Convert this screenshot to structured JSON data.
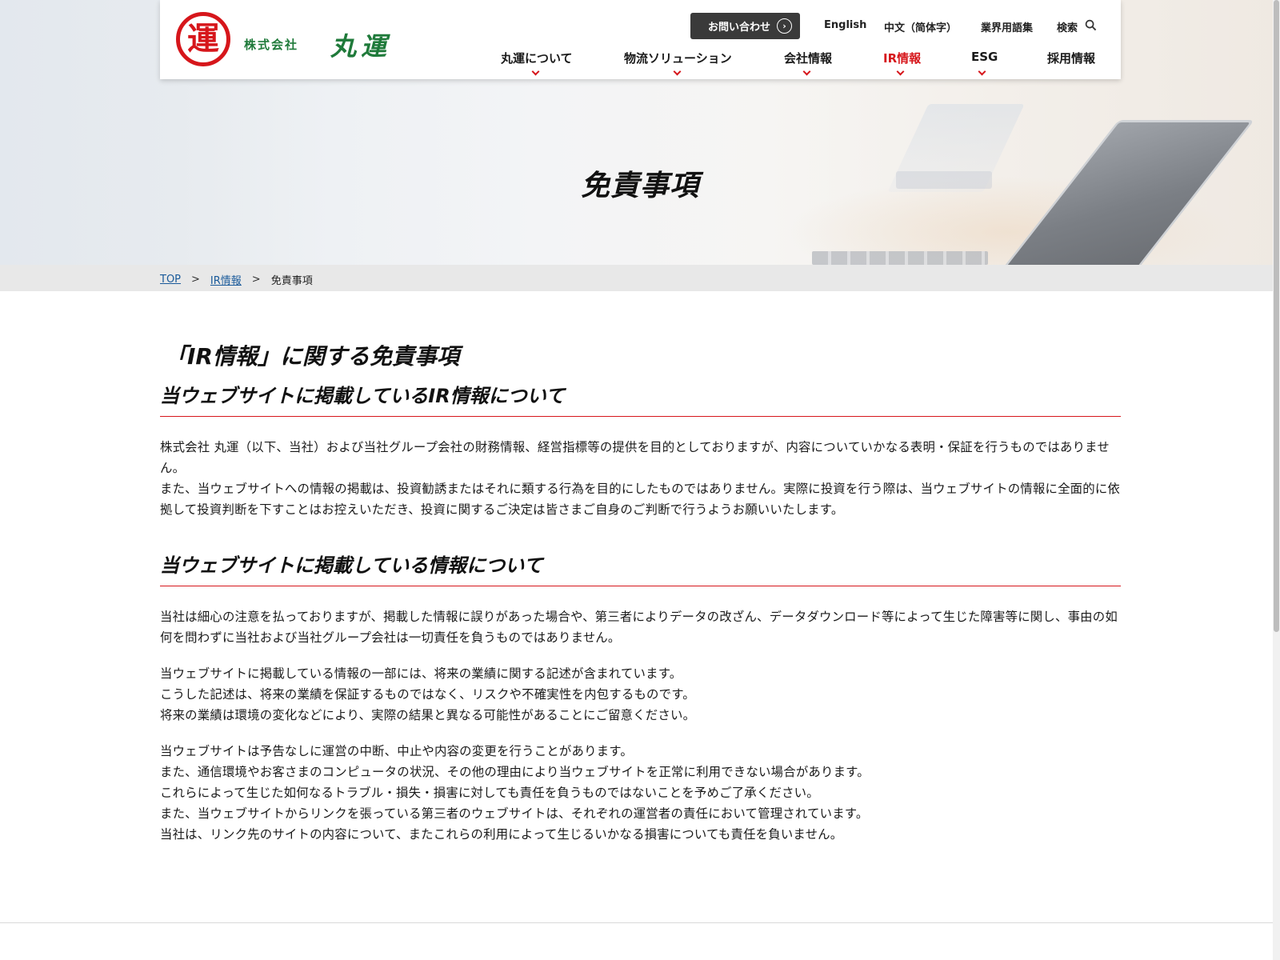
{
  "header": {
    "logo_mark": "運",
    "logo_company": "株式会社",
    "logo_name": "丸運",
    "contact_button": "お問い合わせ",
    "utility_links": [
      "English",
      "中文（简体字）",
      "業界用語集",
      "検索"
    ],
    "nav": [
      "丸運について",
      "物流ソリューション",
      "会社情報",
      "IR情報",
      "ESG",
      "採用情報"
    ],
    "active_nav": "IR情報",
    "brand_color": "#1f7a3a",
    "accent_color": "#d6161b"
  },
  "hero": {
    "title": "免責事項"
  },
  "breadcrumb": {
    "top": "TOP",
    "ir": "IR情報",
    "current": "免責事項",
    "separator": ">"
  },
  "content": {
    "main_heading": "「IR情報」に関する免責事項",
    "section1": {
      "heading": "当ウェブサイトに掲載しているIR情報について",
      "para1": "株式会社 丸運（以下、当社）および当社グループ会社の財務情報、経営指標等の提供を目的としておりますが、内容についていかなる表明・保証を行うものではありません。",
      "para2": "また、当ウェブサイトへの情報の掲載は、投資勧誘またはそれに類する行為を目的にしたものではありません。実際に投資を行う際は、当ウェブサイトの情報に全面的に依拠して投資判断を下すことはお控えいただき、投資に関するご決定は皆さまご自身のご判断で行うようお願いいたします。"
    },
    "section2": {
      "heading": "当ウェブサイトに掲載している情報について",
      "para1": "当社は細心の注意を払っておりますが、掲載した情報に誤りがあった場合や、第三者によりデータの改ざん、データダウンロード等によって生じた障害等に関し、事由の如何を問わずに当社および当社グループ会社は一切責任を負うものではありません。",
      "para2_lines": [
        "当ウェブサイトに掲載している情報の一部には、将来の業績に関する記述が含まれています。",
        "こうした記述は、将来の業績を保証するものではなく、リスクや不確実性を内包するものです。",
        "将来の業績は環境の変化などにより、実際の結果と異なる可能性があることにご留意ください。"
      ],
      "para3_lines": [
        "当ウェブサイトは予告なしに運営の中断、中止や内容の変更を行うことがあります。",
        "また、通信環境やお客さまのコンピュータの状況、その他の理由により当ウェブサイトを正常に利用できない場合があります。",
        "これらによって生じた如何なるトラブル・損失・損害に対しても責任を負うものではないことを予めご了承ください。",
        "また、当ウェブサイトからリンクを張っている第三者のウェブサイトは、それぞれの運営者の責任において管理されています。",
        "当社は、リンク先のサイトの内容について、またこれらの利用によって生じるいかなる損害についても責任を負いません。"
      ]
    }
  }
}
